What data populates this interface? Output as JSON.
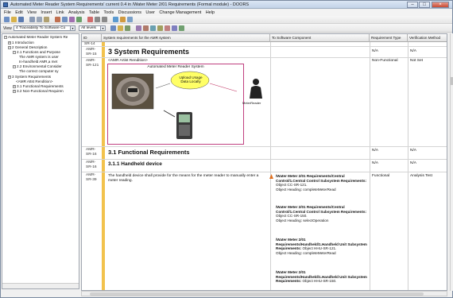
{
  "window": {
    "title": "Automated Meter Reader System Requirements' current 0.4 in /Water Meter 2/01 Requirements (Formal module) - DOORS"
  },
  "menu": [
    "File",
    "Edit",
    "View",
    "Insert",
    "Link",
    "Analysis",
    "Table",
    "Tools",
    "Discussions",
    "User",
    "Change Management",
    "Help"
  ],
  "toolbar2": {
    "view_label": "View",
    "view_value": "4 Traceability To Software Co",
    "levels_value": "All levels"
  },
  "tree": [
    "Automated Meter Reader System Re",
    "1 Introduction",
    "2 General Description",
    "2.1 Functions and Purpose",
    "The AMR system is user",
    "In-handheld AMR,a met",
    "2.2 Environmental Consider",
    "The correct computer sy",
    "3 System Requirements",
    "<AMR Attst Rendition>",
    "3.1 Functional Requirements",
    "3.2 Non-Functional Requiren"
  ],
  "columns": {
    "id": "ID",
    "main": "System requirements for the AMR system",
    "link": "To Software Component",
    "type": "Requirement Type",
    "verif": "Verification Method"
  },
  "rows": {
    "r0": {
      "id": "SR-14"
    },
    "r1": {
      "id": "AMR-SR-15",
      "heading": "3 System Requirements",
      "type": "N/A",
      "verif": "N/A"
    },
    "r2": {
      "id": "AMR-SR-121",
      "label": "<AMR Artist Rendition>",
      "type": "Non-Functional",
      "verif": "Not Set"
    },
    "r3": {
      "id": "AMR-SR-16",
      "heading": "3.1 Functional Requirements",
      "type": "N/A",
      "verif": "N/A"
    },
    "r4": {
      "id": "AMR-SR-16",
      "heading": "3.1.1 Handheld device",
      "type": "N/A",
      "verif": "N/A"
    },
    "r5": {
      "id": "AMR-SR-39",
      "text": "The handheld device shall provide for the means for the meter reader to manually enter a meter reading.",
      "type": "Functional",
      "verif": "Analysis Test"
    }
  },
  "diagram": {
    "title": "Automated Meter Reader System",
    "bubble": "Upload Usage Data Locally",
    "person": "MeterReader"
  },
  "links": [
    {
      "path": "/Water Meter 2/01 Requirements/Central Control/1.Central Control Subsystem Requirements:",
      "rest": "Object CC-SR-121.",
      "heading": "Object Heading: completeMeterRead"
    },
    {
      "path": "/Water Meter 2/01 Requirements/Central Control/1.Central Control Subsystem Requirements:",
      "rest": "Object CC-SR-150.",
      "heading": "Object Heading: selectOperation"
    },
    {
      "path": "/Water Meter 2/01 Requirements/Handheld/1.Handheld Unit Subsystem Requirements:",
      "rest": "Object HHU-SR-121.",
      "heading": "Object Heading: completeMeterRead"
    },
    {
      "path": "/Water Meter 2/01 Requirements/Handheld/1.Handheld Unit Subsystem Requirements:",
      "rest": "Object HHU-SR-150.",
      "heading": ""
    }
  ],
  "colors": {
    "accent": "#f2c24d",
    "diagram_border": "#c04080",
    "bubble": "#ffff66"
  }
}
